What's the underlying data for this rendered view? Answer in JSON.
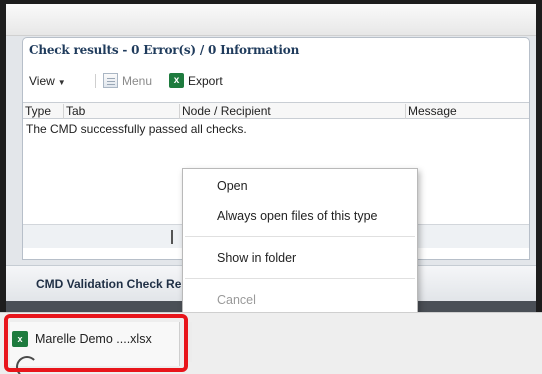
{
  "panel": {
    "title": "Check results - 0 Error(s) / 0 Information",
    "toolbar": {
      "view_label": "View",
      "menu_label": "Menu",
      "export_label": "Export"
    },
    "columns": [
      "Type",
      "Tab",
      "Node / Recipient",
      "Message"
    ],
    "message": "The CMD successfully passed all checks."
  },
  "bottom_tab": {
    "label": "CMD Validation Check Re"
  },
  "context_menu": {
    "items": [
      {
        "label": "Open",
        "enabled": true
      },
      {
        "label": "Always open files of this type",
        "enabled": true
      },
      {
        "label": "Show in folder",
        "enabled": true
      },
      {
        "label": "Cancel",
        "enabled": false
      }
    ]
  },
  "download": {
    "filename": "Marelle Demo ....xlsx",
    "icon": "excel-file-icon",
    "highlight_color": "#e8151b"
  },
  "colors": {
    "title": "#1f3b5c",
    "excel_green": "#1e7b3e"
  }
}
